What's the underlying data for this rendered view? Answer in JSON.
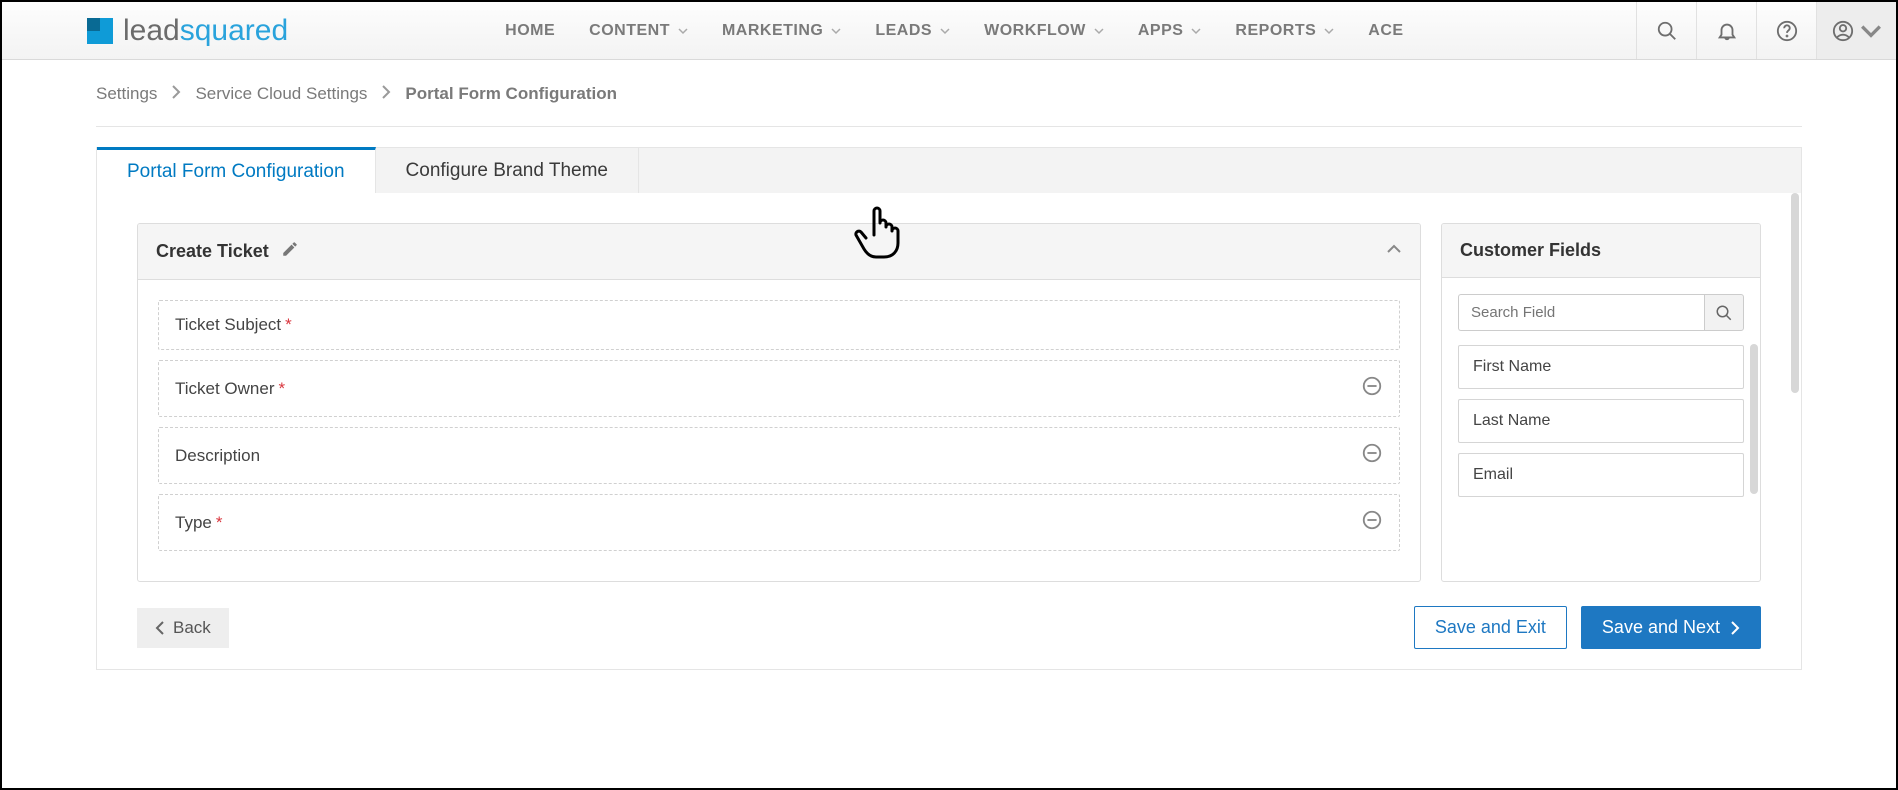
{
  "logo": {
    "part1": "lead",
    "part2": "squared"
  },
  "nav": {
    "items": [
      {
        "label": "HOME",
        "dropdown": false
      },
      {
        "label": "CONTENT",
        "dropdown": true
      },
      {
        "label": "MARKETING",
        "dropdown": true
      },
      {
        "label": "LEADS",
        "dropdown": true
      },
      {
        "label": "WORKFLOW",
        "dropdown": true
      },
      {
        "label": "APPS",
        "dropdown": true
      },
      {
        "label": "REPORTS",
        "dropdown": true
      },
      {
        "label": "ACE",
        "dropdown": false
      }
    ]
  },
  "breadcrumb": {
    "items": [
      "Settings",
      "Service Cloud Settings",
      "Portal Form Configuration"
    ]
  },
  "tabs": {
    "items": [
      {
        "label": "Portal Form Configuration",
        "active": true
      },
      {
        "label": "Configure Brand Theme",
        "active": false
      }
    ]
  },
  "formCard": {
    "title": "Create Ticket",
    "fields": [
      {
        "label": "Ticket Subject",
        "required": true,
        "removable": false
      },
      {
        "label": "Ticket Owner",
        "required": true,
        "removable": true
      },
      {
        "label": "Description",
        "required": false,
        "removable": true
      },
      {
        "label": "Type",
        "required": true,
        "removable": true
      }
    ]
  },
  "sideCard": {
    "title": "Customer Fields",
    "search_placeholder": "Search Field",
    "fields": [
      "First Name",
      "Last Name",
      "Email"
    ]
  },
  "footer": {
    "back": "Back",
    "save_exit": "Save and Exit",
    "save_next": "Save and Next"
  },
  "required_mark": "*"
}
